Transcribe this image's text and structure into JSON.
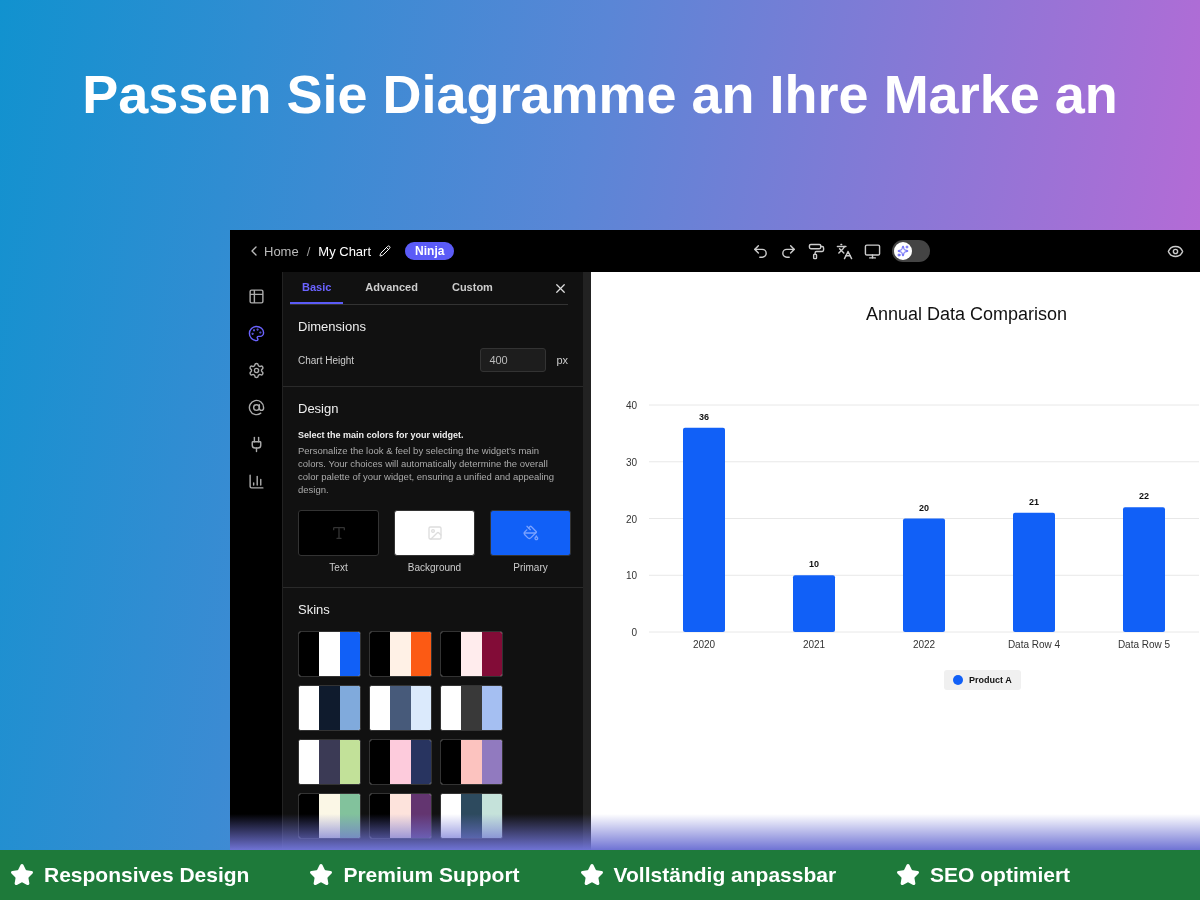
{
  "headline": "Passen Sie Diagramme an Ihre Marke an",
  "topbar": {
    "back": "Home",
    "separator": "/",
    "chart_name": "My Chart",
    "badge": "Ninja",
    "ai_toggle_on": false
  },
  "rail": [
    {
      "kind": "table",
      "selected": false
    },
    {
      "kind": "palette",
      "selected": true
    },
    {
      "kind": "settings",
      "selected": false
    },
    {
      "kind": "at",
      "selected": false
    },
    {
      "kind": "plug",
      "selected": false
    },
    {
      "kind": "chart",
      "selected": false
    }
  ],
  "tabs": [
    {
      "label": "Basic",
      "selected": true
    },
    {
      "label": "Advanced",
      "selected": false
    },
    {
      "label": "Custom",
      "selected": false
    }
  ],
  "dimensions": {
    "title": "Dimensions",
    "label": "Chart Height",
    "value": "400",
    "unit": "px"
  },
  "design": {
    "title": "Design",
    "lead": "Select the main colors for your widget.",
    "text": "Personalize the look & feel by selecting the widget's main colors. Your choices will automatically determine the overall color palette of your widget, ensuring a unified and appealing design.",
    "colors": [
      {
        "kind": "text",
        "label": "Text",
        "color": "#000000"
      },
      {
        "kind": "image",
        "label": "Background",
        "color": "#ffffff"
      },
      {
        "kind": "bucket",
        "label": "Primary",
        "color": "#1160f7"
      }
    ]
  },
  "skins": {
    "title": "Skins",
    "items": [
      {
        "stripes": [
          {
            "color": "#000000"
          },
          {
            "color": "#ffffff"
          },
          {
            "color": "#1160f7"
          }
        ]
      },
      {
        "stripes": [
          {
            "color": "#000000"
          },
          {
            "color": "#fff1e6"
          },
          {
            "color": "#fc5a14"
          }
        ]
      },
      {
        "stripes": [
          {
            "color": "#000000"
          },
          {
            "color": "#ffeced"
          },
          {
            "color": "#820c37"
          }
        ]
      },
      {
        "stripes": [
          {
            "color": "#ffffff"
          },
          {
            "color": "#0f1b2d"
          },
          {
            "color": "#80aadc"
          }
        ]
      },
      {
        "stripes": [
          {
            "color": "#ffffff"
          },
          {
            "color": "#475a7a"
          },
          {
            "color": "#dbeafc"
          }
        ]
      },
      {
        "stripes": [
          {
            "color": "#ffffff"
          },
          {
            "color": "#393939"
          },
          {
            "color": "#a5bff2"
          }
        ]
      },
      {
        "stripes": [
          {
            "color": "#ffffff"
          },
          {
            "color": "#3b3a55"
          },
          {
            "color": "#c2e199"
          }
        ]
      },
      {
        "stripes": [
          {
            "color": "#000000"
          },
          {
            "color": "#fdcbdc"
          },
          {
            "color": "#283460"
          }
        ]
      },
      {
        "stripes": [
          {
            "color": "#000000"
          },
          {
            "color": "#fcc3bf"
          },
          {
            "color": "#917abf"
          }
        ]
      },
      {
        "stripes": [
          {
            "color": "#000000"
          },
          {
            "color": "#fbf7e6"
          },
          {
            "color": "#82c29c"
          }
        ]
      },
      {
        "stripes": [
          {
            "color": "#000000"
          },
          {
            "color": "#fde3dc"
          },
          {
            "color": "#633570"
          }
        ]
      },
      {
        "stripes": [
          {
            "color": "#ffffff"
          },
          {
            "color": "#2d4a5e"
          },
          {
            "color": "#c5e2da"
          }
        ]
      }
    ]
  },
  "chart": {
    "chart_data": {
      "type": "bar",
      "title": "Annual Data Comparison",
      "categories": [
        "2020",
        "2021",
        "2022",
        "Data Row 4",
        "Data Row 5"
      ],
      "series": [
        {
          "name": "Product A",
          "color": "#1160f7",
          "values": [
            36,
            10,
            20,
            21,
            22
          ]
        }
      ],
      "ylim": [
        0,
        40
      ],
      "yticks": [
        0,
        10,
        20,
        30,
        40
      ],
      "grid": true,
      "data_labels": true
    }
  },
  "features": [
    "Responsives Design",
    "Premium Support",
    "Vollständig anpassbar",
    "SEO optimiert"
  ]
}
